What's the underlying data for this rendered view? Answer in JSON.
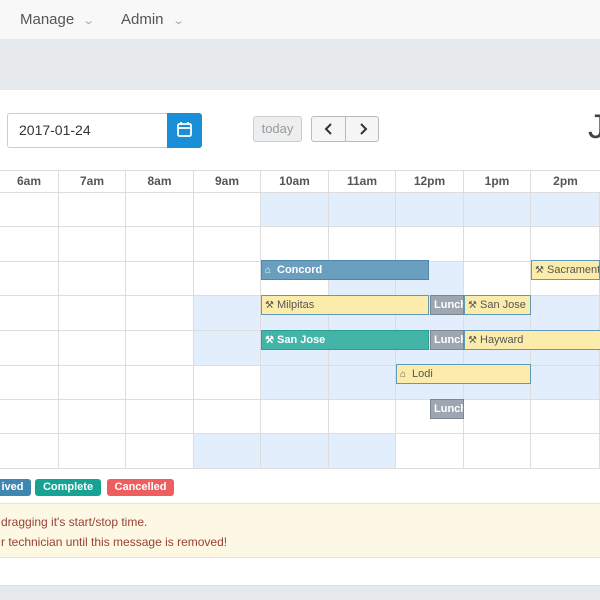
{
  "nav": {
    "items": [
      {
        "label": "Manage"
      },
      {
        "label": "Admin"
      }
    ]
  },
  "toolbar": {
    "date_value": "2017-01-24",
    "today_label": "today",
    "title_fragment": "J"
  },
  "schedule": {
    "hours": [
      "6am",
      "7am",
      "8am",
      "9am",
      "10am",
      "11am",
      "12pm",
      "1pm",
      "2pm"
    ],
    "events": [
      {
        "label": "Concord",
        "icon": "home-icon",
        "color": "blue"
      },
      {
        "label": "Sacrament",
        "icon": "wrench-icon",
        "color": "yellow"
      },
      {
        "label": "Milpitas",
        "icon": "wrench-icon",
        "color": "yellow"
      },
      {
        "label": "Lunch",
        "icon": "",
        "color": "gray"
      },
      {
        "label": "San Jose",
        "icon": "wrench-icon",
        "color": "yellow"
      },
      {
        "label": "San Jose",
        "icon": "wrench-icon",
        "color": "teal"
      },
      {
        "label": "Lunch",
        "icon": "",
        "color": "gray"
      },
      {
        "label": "Hayward",
        "icon": "wrench-icon",
        "color": "yellow"
      },
      {
        "label": "Lodi",
        "icon": "home-icon",
        "color": "yellow"
      },
      {
        "label": "Lunch",
        "icon": "",
        "color": "gray"
      }
    ]
  },
  "legend": [
    {
      "label": "ived",
      "color": "#3f87b0"
    },
    {
      "label": "Complete",
      "color": "#16a394"
    },
    {
      "label": "Cancelled",
      "color": "#ef5e5e"
    }
  ],
  "alert": {
    "line1": "dragging it's start/stop time.",
    "line2": "r technician until this message is removed!"
  },
  "colors": {
    "accent": "#1a8fd8",
    "highlight": "#e3eefc"
  }
}
